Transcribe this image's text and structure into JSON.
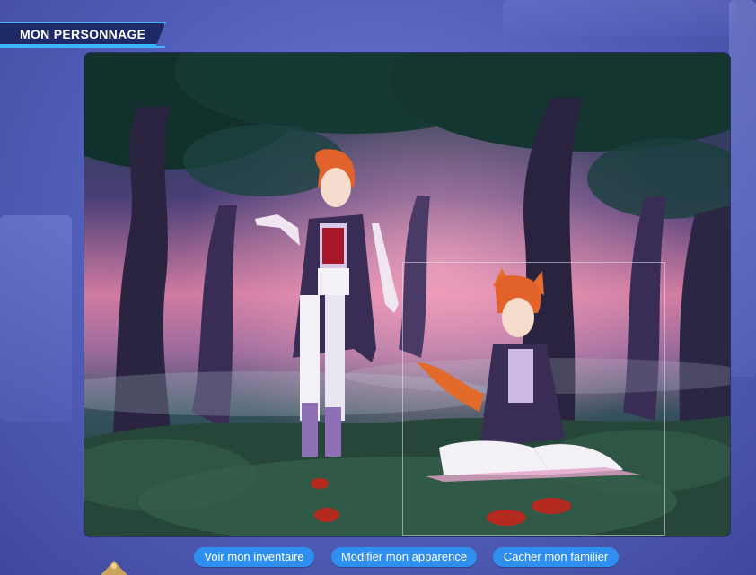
{
  "header": {
    "title": "MON PERSONNAGE"
  },
  "scene": {
    "setting": "forest-at-dusk",
    "pet_frame_visible": true
  },
  "actions": {
    "inventory_label": "Voir mon inventaire",
    "appearance_label": "Modifier mon apparence",
    "hide_pet_label": "Cacher mon familier"
  },
  "colors": {
    "accent": "#3fb5ff",
    "button": "#2f8ff0",
    "background": "#5664c0",
    "title_bg": "#1d2a66"
  }
}
